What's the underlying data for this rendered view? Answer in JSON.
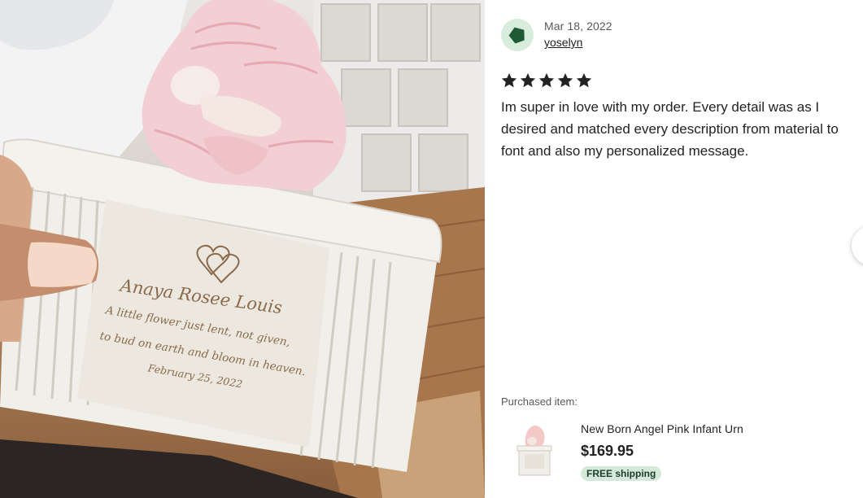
{
  "review": {
    "date": "Mar 18, 2022",
    "reviewer": "yoselyn",
    "rating": 5,
    "text": "Im super in love with my order. Every detail was as I desired and matched every description from material to font and also my personalized message."
  },
  "photo": {
    "engraving": {
      "name": "Anaya Rosee Louis",
      "line1": "A little flower just lent, not given,",
      "line2": "to bud on earth and bloom in heaven.",
      "date": "February 25, 2022"
    }
  },
  "purchase": {
    "label": "Purchased item:",
    "item_title": "New Born Angel Pink Infant Urn",
    "price": "$169.95",
    "shipping": "FREE shipping"
  },
  "colors": {
    "avatar_bg": "#d7ecdb",
    "avatar_shape": "#1f5a35",
    "badge_bg": "#d4e9d7"
  },
  "icons": {
    "star": "star-icon",
    "avatar": "pentagon-avatar-icon",
    "next": "chevron-right-icon"
  }
}
